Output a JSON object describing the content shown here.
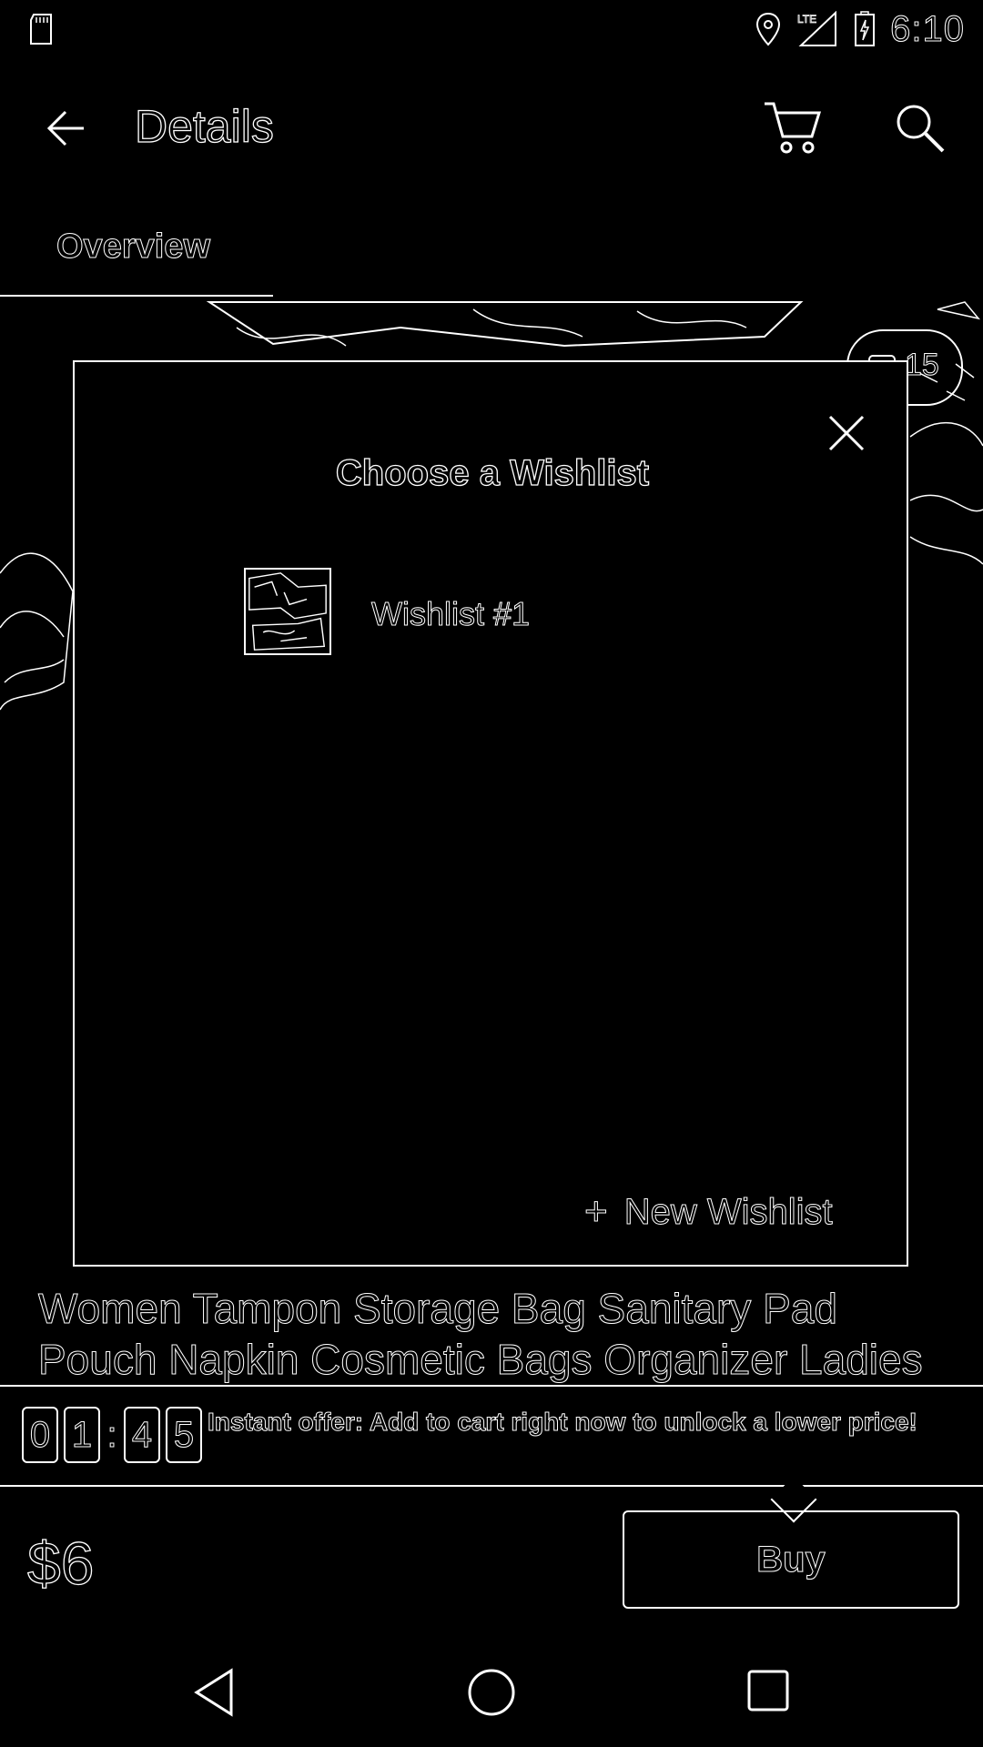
{
  "status_bar": {
    "time": "6:10",
    "network": "LTE",
    "icons": [
      "sd-card-icon",
      "location-icon",
      "signal-icon",
      "battery-charging-icon"
    ]
  },
  "app_bar": {
    "title": "Details",
    "icons": [
      "back-arrow-icon",
      "cart-icon",
      "search-icon"
    ]
  },
  "tabs": [
    {
      "label": "Overview",
      "selected": true
    }
  ],
  "product": {
    "image_counter": "15",
    "title": "Women Tampon Storage Bag Sanitary Pad Pouch Napkin Cosmetic Bags Organizer Ladies",
    "price": "$6"
  },
  "offer": {
    "timer_digits": [
      "0",
      "1",
      "4",
      "5"
    ],
    "separator": ":",
    "text": "Instant offer: Add to cart right now to unlock a lower price!"
  },
  "buy_label": "Buy",
  "dialog": {
    "title": "Choose a Wishlist",
    "items": [
      {
        "name": "Wishlist #1"
      }
    ],
    "new_wishlist_label": "New Wishlist",
    "new_wishlist_icon": "+"
  },
  "nav_bar": {
    "icons": [
      "nav-back-icon",
      "nav-home-icon",
      "nav-recents-icon"
    ]
  }
}
